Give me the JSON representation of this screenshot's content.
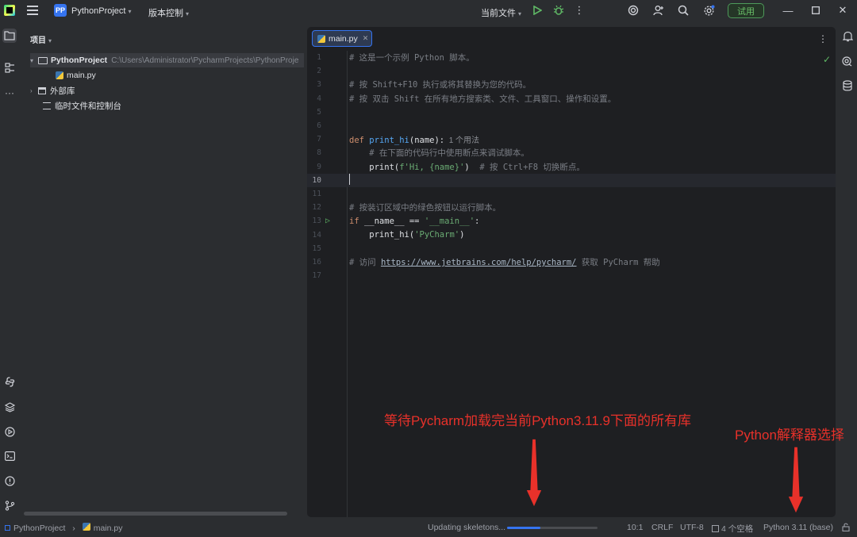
{
  "titlebar": {
    "project_badge": "PP",
    "project_name": "PythonProject",
    "vcs_label": "版本控制",
    "run_config": "当前文件",
    "trial_label": "试用"
  },
  "project_panel": {
    "title": "项目",
    "root_name": "PythonProject",
    "root_path": "C:\\Users\\Administrator\\PycharmProjects\\PythonProje",
    "file": "main.py",
    "external_libs": "外部库",
    "scratches": "临时文件和控制台"
  },
  "editor": {
    "tab_label": "main.py",
    "lines": [
      {
        "n": "1",
        "text": "# 这是一个示例 Python 脚本。"
      },
      {
        "n": "2",
        "text": ""
      },
      {
        "n": "3",
        "text": "# 按 Shift+F10 执行或将其替换为您的代码。"
      },
      {
        "n": "4",
        "text": "# 按 双击 Shift 在所有地方搜索类、文件、工具窗口、操作和设置。"
      },
      {
        "n": "5",
        "text": ""
      },
      {
        "n": "6",
        "text": ""
      },
      {
        "n": "7",
        "kw": "def ",
        "fn": "print_hi",
        "rest": "(name):",
        "hint": "  1 个用法"
      },
      {
        "n": "8",
        "text": "    # 在下面的代码行中使用断点来调试脚本。"
      },
      {
        "n": "9",
        "pre": "    print(",
        "str": "f'Hi, {name}'",
        "post": ")  ",
        "cmt": "# 按 Ctrl+F8 切换断点。"
      },
      {
        "n": "10",
        "text": ""
      },
      {
        "n": "11",
        "text": ""
      },
      {
        "n": "12",
        "text": "# 按装订区域中的绿色按钮以运行脚本。"
      },
      {
        "n": "13",
        "kw": "if ",
        "mid": "__name__ == ",
        "str": "'__main__'",
        "post": ":"
      },
      {
        "n": "14",
        "pre": "    print_hi(",
        "str": "'PyCharm'",
        "post": ")"
      },
      {
        "n": "15",
        "text": ""
      },
      {
        "n": "16",
        "c1": "# 访问 ",
        "url": "https://www.jetbrains.com/help/pycharm/",
        "c2": " 获取 PyCharm 帮助"
      },
      {
        "n": "17",
        "text": ""
      }
    ]
  },
  "statusbar": {
    "crumb_project": "PythonProject",
    "crumb_file": "main.py",
    "progress_text": "Updating skeletons...",
    "progress_value": 0.37,
    "position": "10:1",
    "line_sep": "CRLF",
    "encoding": "UTF-8",
    "indent": "4 个空格",
    "interpreter": "Python 3.11 (base)"
  },
  "annotations": {
    "loading_note": "等待Pycharm加载完当前Python3.11.9下面的所有库",
    "interpreter_note": "Python解释器选择"
  },
  "colors": {
    "accent": "#3574f0",
    "annotation": "#e8312a",
    "run_green": "#5fb865"
  }
}
